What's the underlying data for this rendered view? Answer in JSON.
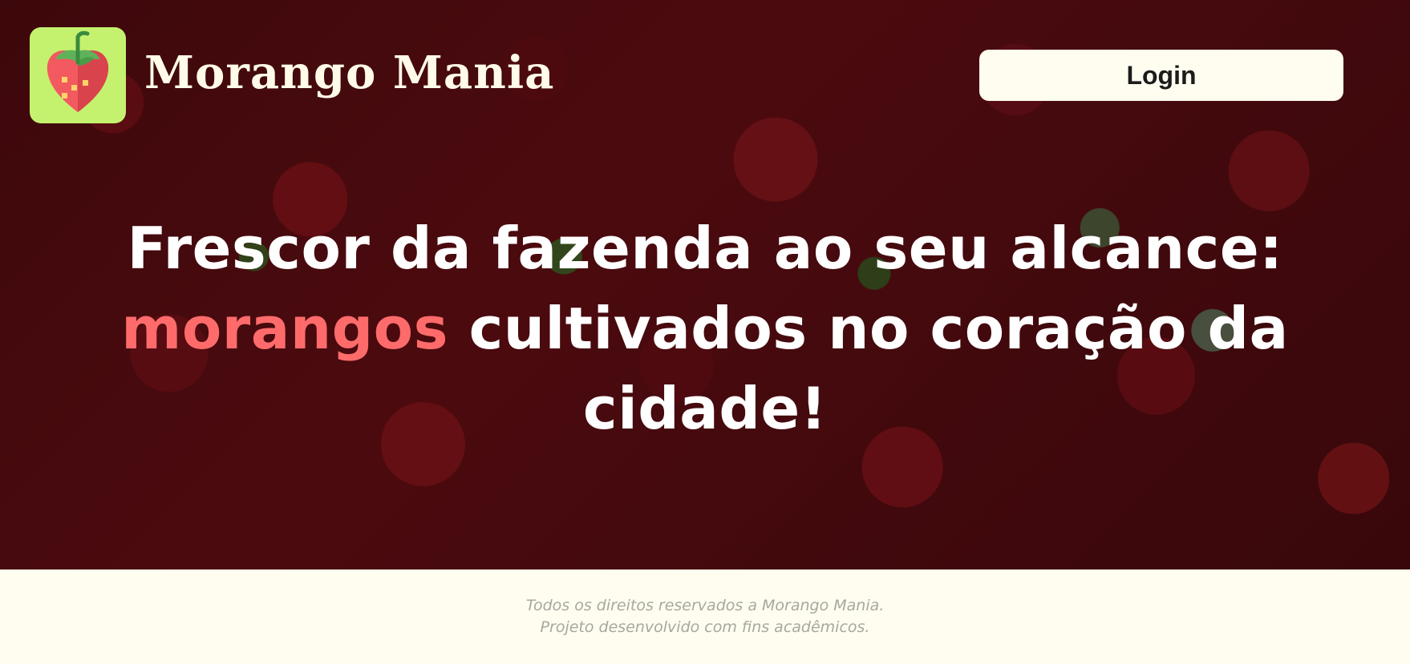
{
  "header": {
    "logo_icon": "strawberry-icon",
    "brand_name": "Morango Mania",
    "login_label": "Login"
  },
  "hero": {
    "background_image": "strawberries-photo",
    "headline_part1": "Frescor da fazenda ao seu alcance:",
    "headline_accent": "morangos",
    "headline_part2": " cultivados no coração da cidade!"
  },
  "footer": {
    "line1": "Todos os direitos reservados a Morango Mania.",
    "line2": "Projeto desenvolvido com fins acadêmicos."
  },
  "colors": {
    "accent": "#ff6b6b",
    "logo_bg": "#c5f26e",
    "cream": "#fffdf0"
  }
}
